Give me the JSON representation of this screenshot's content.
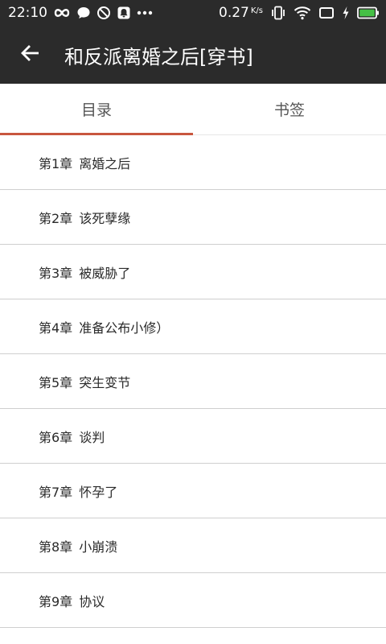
{
  "status_bar": {
    "time": "22:10",
    "speed_value": "0.27",
    "speed_unit": "K/s"
  },
  "icons": {
    "infinity": "infinity-icon",
    "message": "message-icon",
    "block": "block-icon",
    "notification": "notification-icon",
    "more": "more-icon",
    "vibrate": "vibrate-icon",
    "wifi": "wifi-icon",
    "screen": "screen-icon",
    "charging": "charging-icon",
    "battery": "battery-icon",
    "back": "back-arrow-icon"
  },
  "colors": {
    "app_bar": "#2b2b2b",
    "tab_indicator": "#c8563e",
    "battery": "#46c046"
  },
  "app_bar": {
    "title": "和反派离婚之后[穿书]"
  },
  "tabs": [
    {
      "label": "目录",
      "active": true
    },
    {
      "label": "书签",
      "active": false
    }
  ],
  "chapters": [
    {
      "number": "第1章",
      "title": "离婚之后"
    },
    {
      "number": "第2章",
      "title": "该死孽缘"
    },
    {
      "number": "第3章",
      "title": "被威胁了"
    },
    {
      "number": "第4章",
      "title": "准备公布小修）"
    },
    {
      "number": "第5章",
      "title": "突生变节"
    },
    {
      "number": "第6章",
      "title": "谈判"
    },
    {
      "number": "第7章",
      "title": "怀孕了"
    },
    {
      "number": "第8章",
      "title": "小崩溃"
    },
    {
      "number": "第9章",
      "title": "协议"
    }
  ]
}
